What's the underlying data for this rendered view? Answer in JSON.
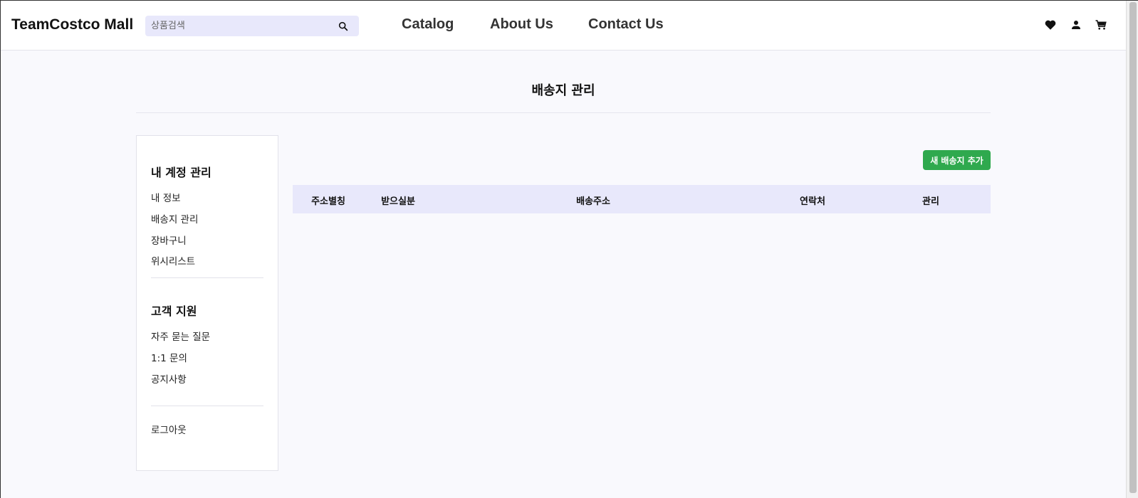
{
  "header": {
    "brand": "TeamCostco Mall",
    "search_placeholder": "상품검색",
    "nav": [
      "Catalog",
      "About Us",
      "Contact Us"
    ],
    "icons": [
      "heart-icon",
      "user-icon",
      "cart-icon"
    ]
  },
  "page": {
    "title": "배송지 관리"
  },
  "sidebar": {
    "account_title": "내 계정 관리",
    "account_items": [
      "내 정보",
      "배송지 관리",
      "장바구니",
      "위시리스트"
    ],
    "support_title": "고객 지원",
    "support_items": [
      "자주 묻는 질문",
      "1:1 문의",
      "공지사항"
    ],
    "logout": "로그아웃"
  },
  "main": {
    "add_button": "새 배송지 추가",
    "columns": [
      "주소별칭",
      "받으실분",
      "배송주소",
      "연락처",
      "관리"
    ],
    "rows": []
  },
  "colors": {
    "accent_green": "#2fa94e",
    "table_header_bg": "#e8e8fb",
    "search_bg": "#e8e8fb"
  }
}
